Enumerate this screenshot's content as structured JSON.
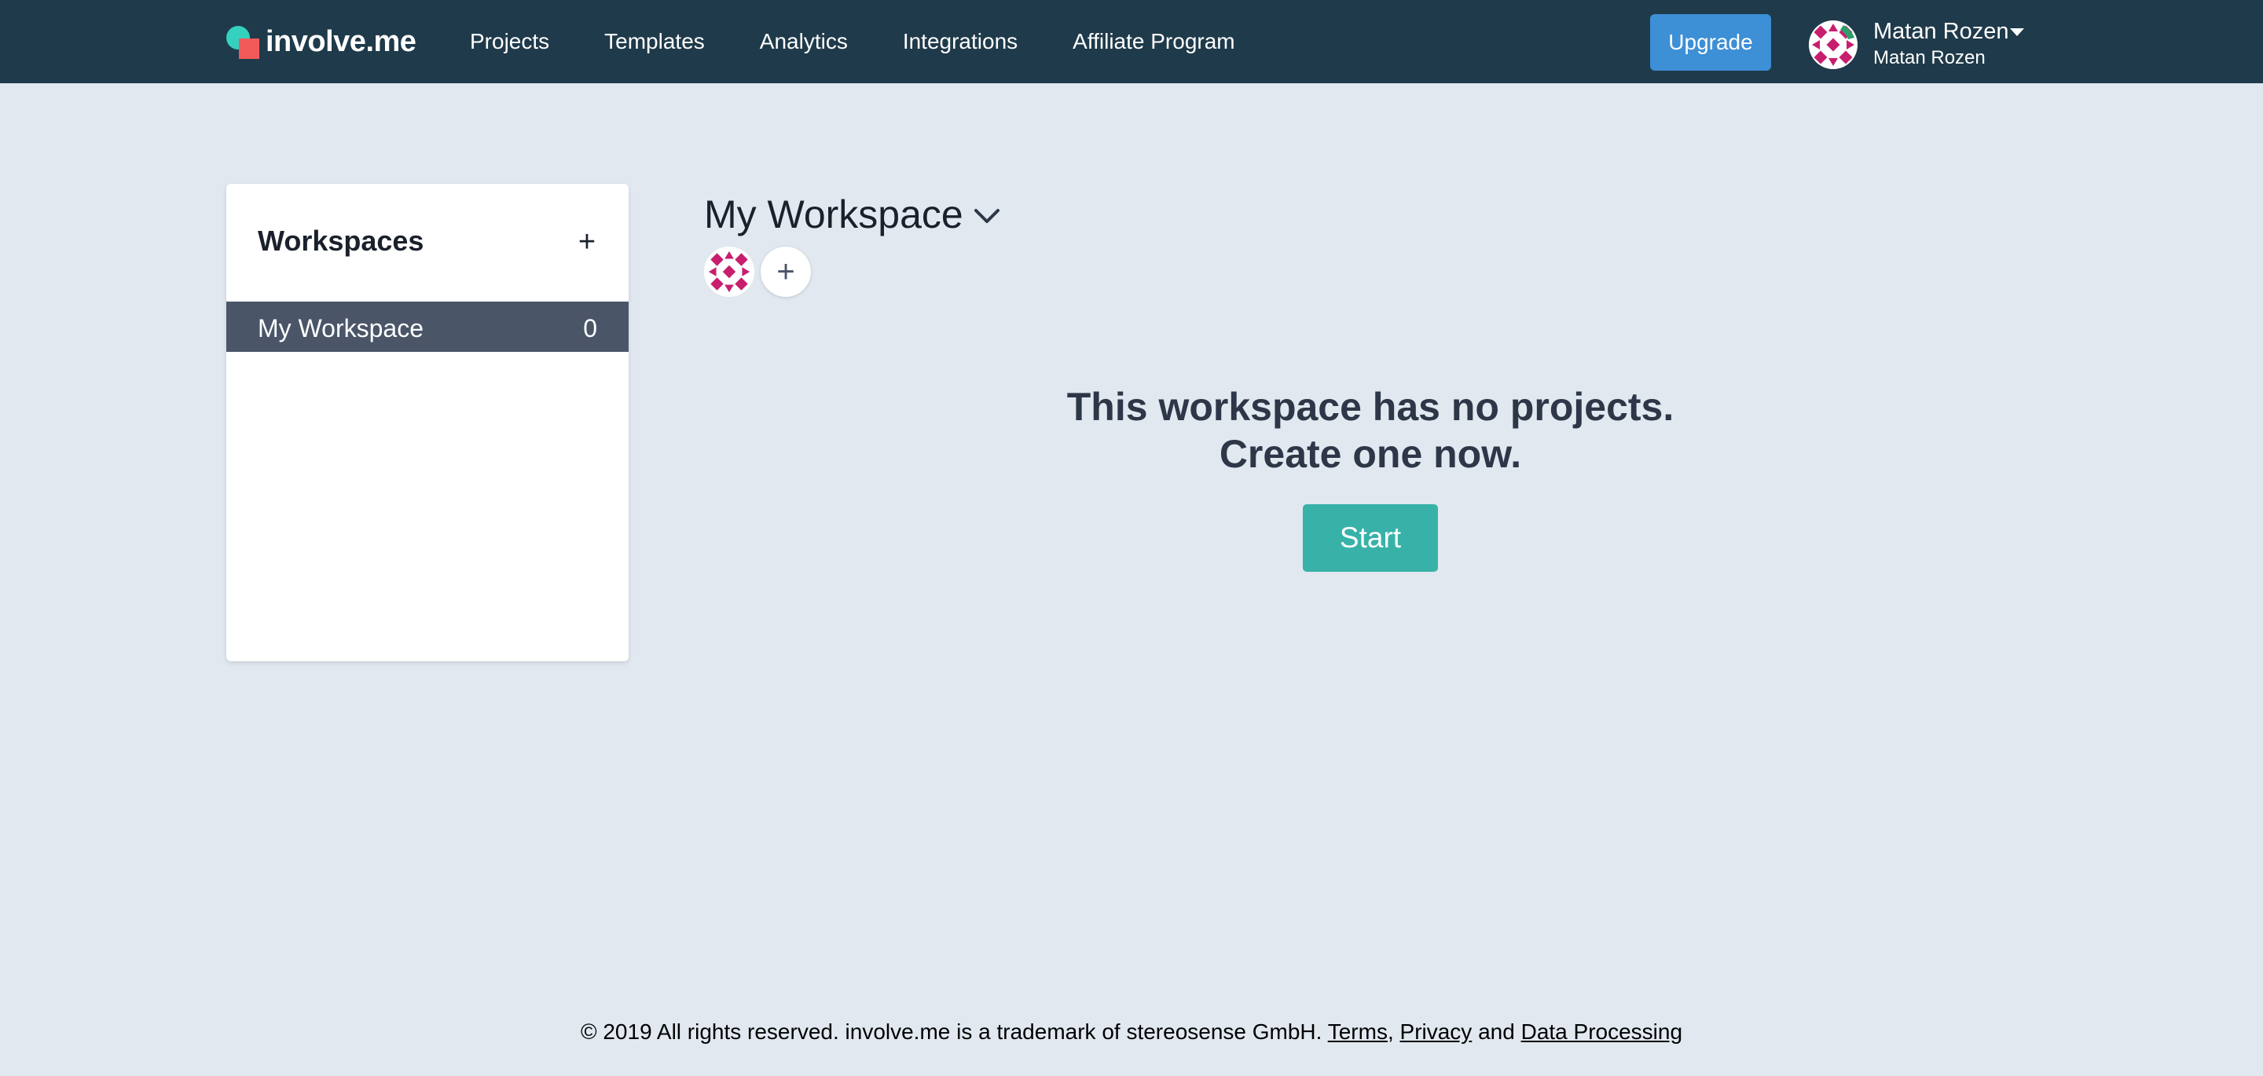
{
  "brand": {
    "name": "involve.me"
  },
  "nav": {
    "items": [
      {
        "label": "Projects"
      },
      {
        "label": "Templates"
      },
      {
        "label": "Analytics"
      },
      {
        "label": "Integrations"
      },
      {
        "label": "Affiliate Program"
      }
    ],
    "upgrade_label": "Upgrade"
  },
  "user": {
    "name": "Matan Rozen",
    "subtitle": "Matan Rozen",
    "avatar_icon": "geometric-pattern-avatar"
  },
  "sidebar": {
    "title": "Workspaces",
    "add_label": "+",
    "items": [
      {
        "label": "My Workspace",
        "count": "0"
      }
    ]
  },
  "main": {
    "workspace_title": "My Workspace",
    "add_member_label": "+",
    "empty_line1": "This workspace has no projects.",
    "empty_line2": "Create one now.",
    "start_label": "Start"
  },
  "footer": {
    "text": "© 2019 All rights reserved. involve.me is a trademark of stereosense GmbH.",
    "terms": "Terms",
    "sep1": ",",
    "privacy": "Privacy",
    "and": "and",
    "data_processing": "Data Processing"
  },
  "colors": {
    "topbar": "#1f3a4a",
    "background": "#e1e8f0",
    "upgrade": "#3d8fd6",
    "start": "#38b2a8",
    "selected_item": "#4a5568",
    "avatar_pattern": "#c81e6e"
  }
}
